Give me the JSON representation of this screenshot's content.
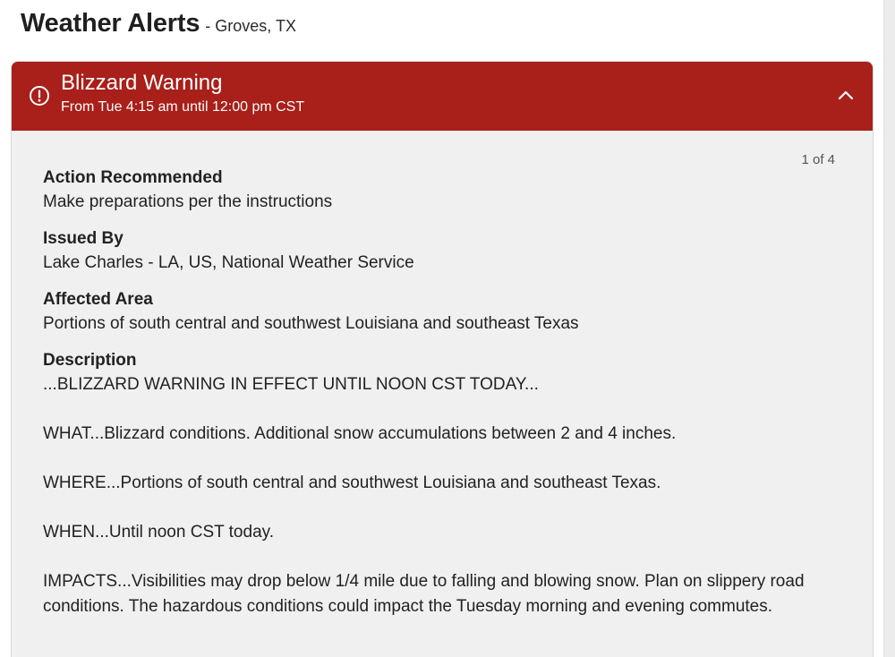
{
  "header": {
    "title": "Weather Alerts",
    "location": "- Groves, TX"
  },
  "alert": {
    "icon": "exclamation-circle-icon",
    "title": "Blizzard Warning",
    "time": "From Tue 4:15 am until 12:00 pm CST",
    "collapse_icon": "chevron-up-icon",
    "color": "#a91f1a",
    "pager": "1 of 4",
    "action": {
      "label": "Action Recommended",
      "value": "Make preparations per the instructions"
    },
    "issued_by": {
      "label": "Issued By",
      "value": "Lake Charles - LA, US, National Weather Service"
    },
    "affected_area": {
      "label": "Affected Area",
      "value": "Portions of south central and southwest Louisiana and southeast Texas"
    },
    "description": {
      "label": "Description",
      "paragraphs": [
        "...BLIZZARD WARNING IN EFFECT UNTIL NOON CST TODAY...",
        "WHAT...Blizzard conditions. Additional snow accumulations between 2 and 4 inches.",
        "WHERE...Portions of south central and southwest Louisiana and southeast Texas.",
        "WHEN...Until noon CST today.",
        "IMPACTS...Visibilities may drop below 1/4 mile due to falling and blowing snow. Plan on slippery road conditions. The hazardous conditions could impact the Tuesday morning and evening commutes."
      ]
    }
  }
}
